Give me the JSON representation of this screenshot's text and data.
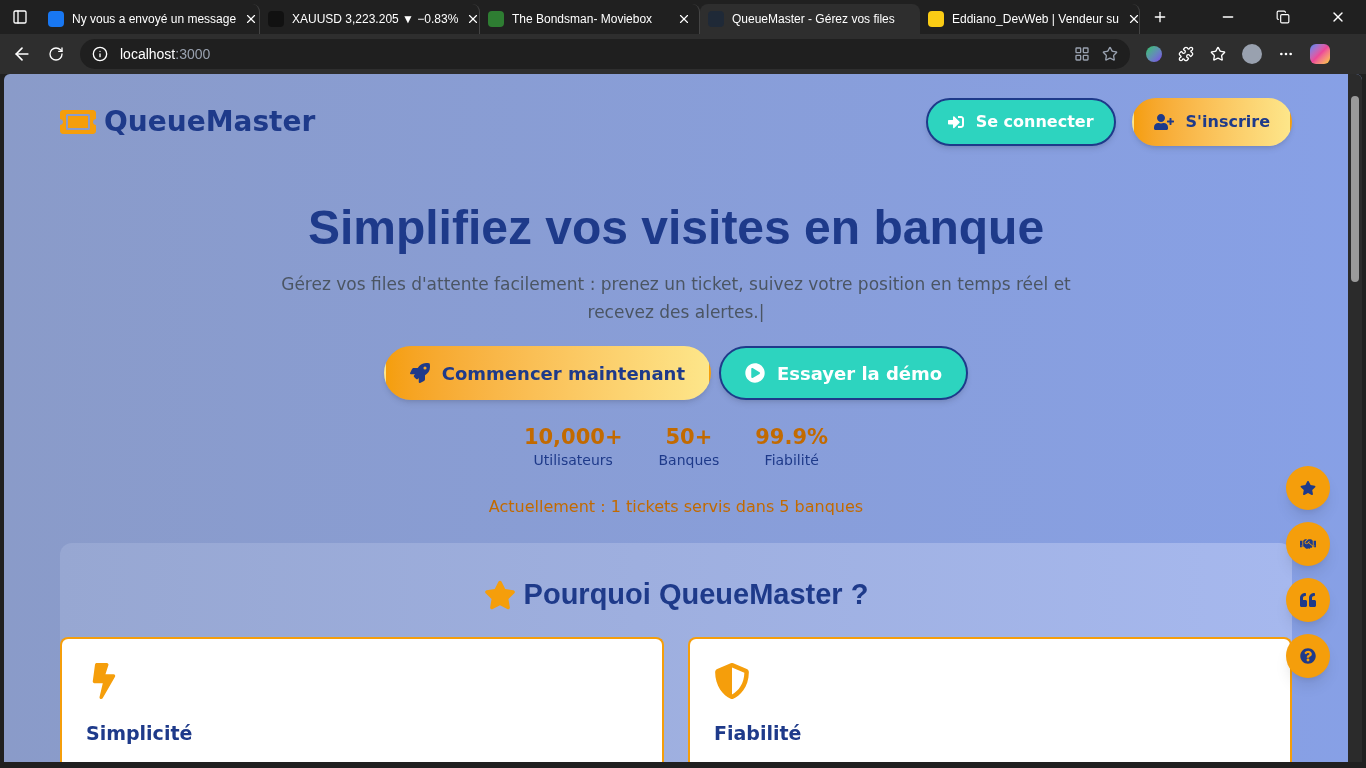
{
  "browser": {
    "tabs": [
      {
        "title": "Ny vous a envoyé un message",
        "selected": false
      },
      {
        "title": "XAUUSD 3,223.205 ▼ −0.83%",
        "selected": false
      },
      {
        "title": "The Bondsman- Moviebox",
        "selected": false
      },
      {
        "title": "QueueMaster - Gérez vos files",
        "selected": true
      },
      {
        "title": "Eddiano_DevWeb | Vendeur su",
        "selected": false
      }
    ],
    "address": {
      "host": "localhost",
      "port": ":3000"
    }
  },
  "nav": {
    "logo": "QueueMaster",
    "buttons": [
      {
        "label": "Se connecter",
        "kind": "outline"
      },
      {
        "label": "S'inscrire",
        "kind": "gradient"
      }
    ]
  },
  "hero": {
    "title": "Simplifiez vos visites en banque",
    "subtitle": "Gérez vos files d'attente facilement : prenez un ticket, suivez votre position en temps réel et recevez des alertes.|",
    "buttons": [
      {
        "label": "Commencer maintenant",
        "kind": "gradient"
      },
      {
        "label": "Essayer la démo",
        "kind": "outline"
      }
    ],
    "stats": [
      {
        "value": "10,000+",
        "label": "Utilisateurs"
      },
      {
        "value": "50+",
        "label": "Banques"
      },
      {
        "value": "99.9%",
        "label": "Fiabilité"
      }
    ],
    "live": "Actuellement : 1 tickets servis dans 5 banques"
  },
  "features": {
    "title": "Pourquoi QueueMaster ?",
    "cards": [
      {
        "title": "Simplicité"
      },
      {
        "title": "Fiabilité"
      }
    ]
  }
}
